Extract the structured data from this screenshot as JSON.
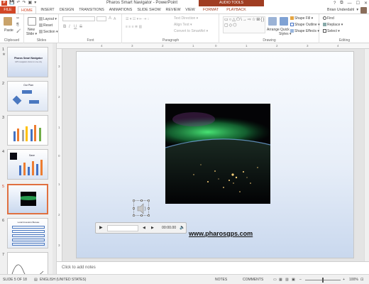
{
  "window": {
    "app_icon": "P",
    "title": "Pharos Smart Navigator - PowerPoint",
    "context_header": "AUDIO TOOLS",
    "controls": {
      "help": "?",
      "ribbon_display": "⧉",
      "minimize": "—",
      "maximize": "☐",
      "close": "✕"
    }
  },
  "qat": {
    "save": "💾",
    "undo": "↶",
    "redo": "↷",
    "start": "▣",
    "customize": "▾"
  },
  "tabs": {
    "file": "FILE",
    "home": "HOME",
    "insert": "INSERT",
    "design": "DESIGN",
    "transitions": "TRANSITIONS",
    "animations": "ANIMATIONS",
    "slideshow": "SLIDE SHOW",
    "review": "REVIEW",
    "view": "VIEW",
    "format": "FORMAT",
    "playback": "PLAYBACK"
  },
  "user": {
    "name": "Brian Underdahl",
    "menu": "▾"
  },
  "ribbon": {
    "clipboard": {
      "label": "Clipboard",
      "paste": "Paste",
      "cut": "✂",
      "copy": "⎘",
      "painter": "🖌"
    },
    "slides": {
      "label": "Slides",
      "new_slide": "New",
      "new_slide2": "Slide ▾",
      "layout": "Layout ▾",
      "reset": "Reset",
      "section": "Section ▾"
    },
    "font": {
      "label": "Font",
      "bold": "B",
      "italic": "I",
      "underline": "U",
      "strike": "S",
      "grow": "A",
      "shrink": "A"
    },
    "paragraph": {
      "label": "Paragraph",
      "text_direction": "Text Direction ▾",
      "align_text": "Align Text ▾",
      "smartart": "Convert to SmartArt ▾"
    },
    "drawing": {
      "label": "Drawing",
      "shapes_glyphs": "▭○△⬠\\→⇨☆⊞{}▢◇⬡",
      "arrange": "Arrange",
      "quick_styles": "Quick",
      "quick_styles2": "Styles ▾",
      "shape_fill": "Shape Fill ▾",
      "shape_outline": "Shape Outline ▾",
      "shape_effects": "Shape Effects ▾"
    },
    "editing": {
      "label": "Editing",
      "find": "Find",
      "replace": "Replace ▾",
      "select": "Select ▾"
    }
  },
  "thumbnails": [
    {
      "num": "1",
      "title": "Pharos Smart Navigator",
      "subtitle": "GPS navigation shown in one only",
      "selected": false,
      "star": "★"
    },
    {
      "num": "2",
      "title": "Our Plan",
      "selected": false
    },
    {
      "num": "3",
      "title": "",
      "selected": false
    },
    {
      "num": "4",
      "title": "Save",
      "selected": false
    },
    {
      "num": "5",
      "title": "",
      "selected": true
    },
    {
      "num": "6",
      "title": "Local Investors Bureau",
      "selected": false
    },
    {
      "num": "7",
      "title": "",
      "selected": false
    }
  ],
  "ruler": {
    "h": [
      "4",
      "3",
      "2",
      "1",
      "0",
      "1",
      "2",
      "3",
      "4"
    ],
    "v": [
      "3",
      "2",
      "1",
      "0",
      "1",
      "2",
      "3"
    ]
  },
  "slide": {
    "url": "www.pharosgps.com",
    "media": {
      "play": "▶",
      "back": "◀",
      "fwd": "▶",
      "time": "00:00.00",
      "volume": "🔈"
    }
  },
  "notes": {
    "placeholder": "Click to add notes"
  },
  "status": {
    "slide_pos": "SLIDE 5 OF 18",
    "language": "ENGLISH (UNITED STATES)",
    "notes": "NOTES",
    "comments": "COMMENTS",
    "zoom": "100%"
  },
  "colors": {
    "accent": "#d24726",
    "context": "#a03d22",
    "thumb_selected": "#e07040"
  }
}
